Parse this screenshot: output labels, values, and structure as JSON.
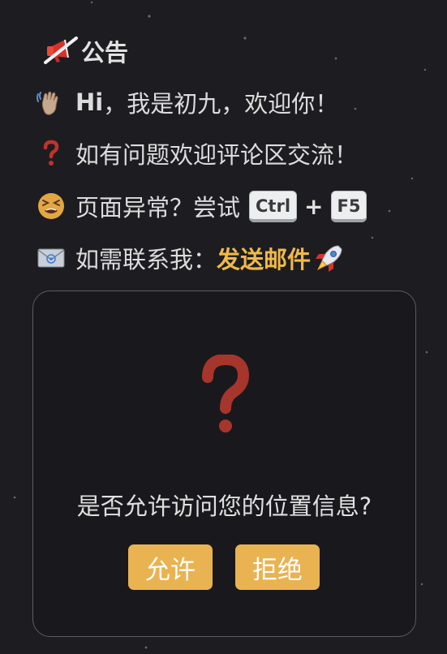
{
  "notice": {
    "title": "公告",
    "greeting_name": "Hi",
    "greeting_rest": "，我是初九，欢迎你！",
    "question_line": "如有问题欢迎评论区交流！",
    "abnormal_text": "页面异常？尝试",
    "key_ctrl": "Ctrl",
    "key_plus": "+",
    "key_f5": "F5",
    "contact_text": "如需联系我：",
    "contact_link": "发送邮件",
    "icons": {
      "title": "megaphone-icon",
      "greeting": "waving-hand-icon",
      "question": "red-question-icon",
      "abnormal": "tired-face-icon",
      "contact": "envelope-icon",
      "link": "rocket-icon"
    }
  },
  "location_dialog": {
    "icon": "question-mark-icon",
    "message": "是否允许访问您的位置信息?",
    "allow_label": "允许",
    "deny_label": "拒绝"
  },
  "colors": {
    "background": "#1d1d21",
    "accent": "#e9b351",
    "link": "#f0b948",
    "question_red": "#b03a2e"
  }
}
